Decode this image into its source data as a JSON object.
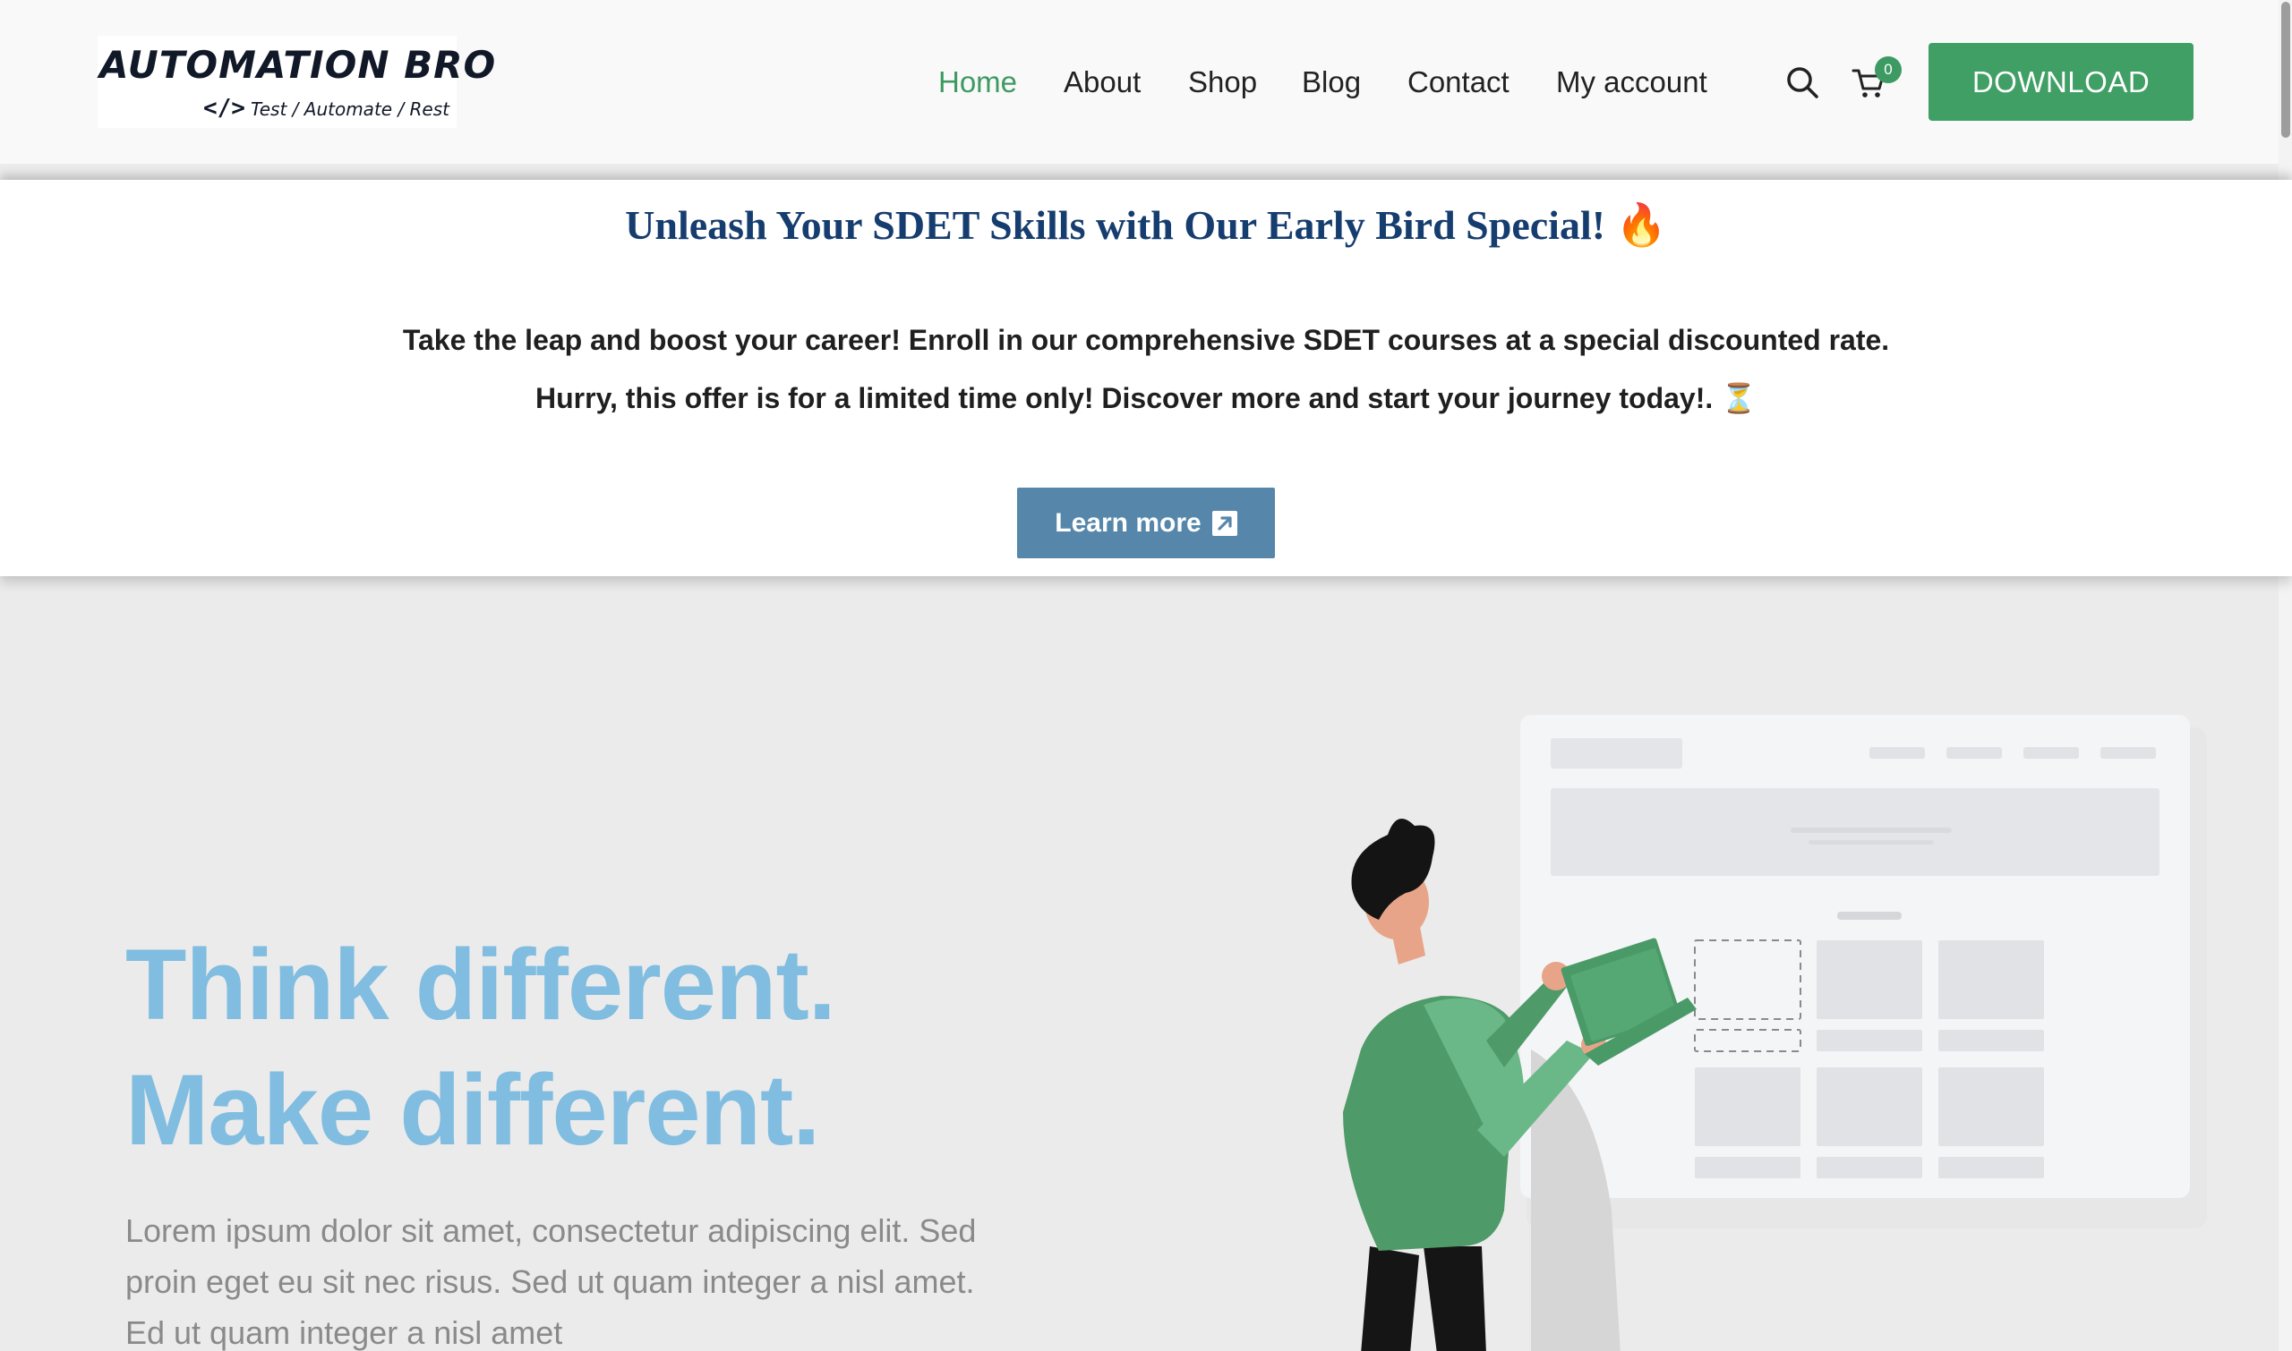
{
  "header": {
    "logo": {
      "title": "AUTOMATION BRO",
      "code_glyph": "</>",
      "tagline": "Test / Automate / Rest"
    },
    "nav": {
      "home": "Home",
      "about": "About",
      "shop": "Shop",
      "blog": "Blog",
      "contact": "Contact",
      "my_account": "My account"
    },
    "cart_count": "0",
    "download_label": "DOWNLOAD",
    "icons": {
      "search": "search-icon",
      "cart": "cart-icon"
    }
  },
  "promo": {
    "title": "Unleash Your SDET Skills with Our Early Bird Special! 🔥",
    "line1": "Take the leap and boost your career! Enroll in our comprehensive SDET courses at a special discounted rate.",
    "line2": "Hurry, this offer is for a limited time only! Discover more and start your journey today!. ⏳",
    "button_label": "Learn more",
    "button_icon": "external-link-icon"
  },
  "hero": {
    "headline_line1": "Think different.",
    "headline_line2": "Make different.",
    "body": "Lorem ipsum dolor sit amet, consectetur adipiscing elit. Sed proin eget eu sit nec risus. Sed ut quam integer a nisl amet.  Ed ut quam integer a nisl amet"
  },
  "colors": {
    "accent_green": "#409f64",
    "promo_title": "#163d6f",
    "learn_more_bg": "#5687aa",
    "hero_headline": "#80bde0"
  }
}
